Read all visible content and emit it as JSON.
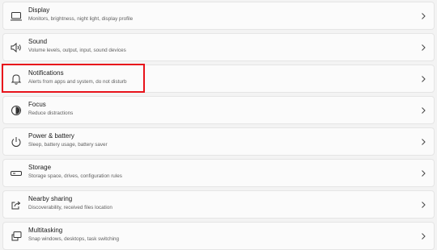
{
  "settings": {
    "items": [
      {
        "title": "Display",
        "description": "Monitors, brightness, night light, display profile",
        "icon": "monitor-icon"
      },
      {
        "title": "Sound",
        "description": "Volume levels, output, input, sound devices",
        "icon": "speaker-icon"
      },
      {
        "title": "Notifications",
        "description": "Alerts from apps and system, do not disturb",
        "icon": "bell-icon"
      },
      {
        "title": "Focus",
        "description": "Reduce distractions",
        "icon": "focus-icon"
      },
      {
        "title": "Power & battery",
        "description": "Sleep, battery usage, battery saver",
        "icon": "power-icon"
      },
      {
        "title": "Storage",
        "description": "Storage space, drives, configuration rules",
        "icon": "storage-icon"
      },
      {
        "title": "Nearby sharing",
        "description": "Discoverability, received files location",
        "icon": "share-icon"
      },
      {
        "title": "Multitasking",
        "description": "Snap windows, desktops, task switching",
        "icon": "multitask-icon"
      }
    ]
  },
  "colors": {
    "page_background": "#f3f3f3",
    "card_background": "#fbfbfb",
    "highlight": "#e8131b"
  }
}
